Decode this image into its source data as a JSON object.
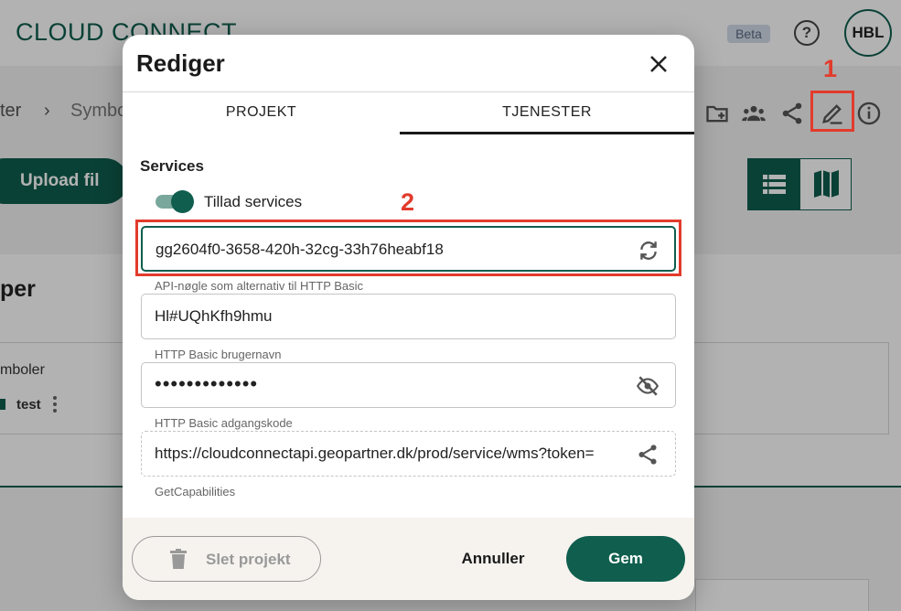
{
  "app": {
    "brand": "CLOUD CONNECT",
    "beta_badge": "Beta",
    "help_glyph": "?",
    "user_initials": "HBL",
    "accent_color": "#0f5e4e",
    "annotation_color": "#e23b2c"
  },
  "breadcrumb": {
    "item1": "ter",
    "separator": "›",
    "item2": "Symbo"
  },
  "toolbar": {
    "icons": [
      "new-folder-icon",
      "users-icon",
      "share-icon",
      "edit-icon",
      "info-icon"
    ]
  },
  "annotations": {
    "marker1": "1",
    "marker2": "2"
  },
  "page": {
    "upload_label": "Upload fil",
    "section_title": "per",
    "card_label": "mboler",
    "card_item": "test"
  },
  "modal": {
    "title": "Rediger",
    "tabs": [
      {
        "label": "PROJEKT",
        "active": false
      },
      {
        "label": "TJENESTER",
        "active": true
      }
    ],
    "section_label": "Services",
    "toggle": {
      "label": "Tillad services",
      "on": true
    },
    "fields": {
      "api_key": {
        "value": "gg2604f0-3658-420h-32cg-33h76heabf18",
        "caption": "API-nøgle som alternativ til HTTP Basic",
        "icon": "refresh-icon"
      },
      "username": {
        "value": "Hl#UQhKfh9hmu",
        "caption": "HTTP Basic brugernavn"
      },
      "password": {
        "value": "•••••••••••••",
        "caption": "HTTP Basic adgangskode",
        "icon": "eye-off-icon"
      },
      "url": {
        "value": "https://cloudconnectapi.geopartner.dk/prod/service/wms?token=",
        "caption": "GetCapabilities",
        "icon": "share-icon"
      }
    },
    "footer": {
      "delete_label": "Slet projekt",
      "cancel_label": "Annuller",
      "save_label": "Gem"
    }
  }
}
